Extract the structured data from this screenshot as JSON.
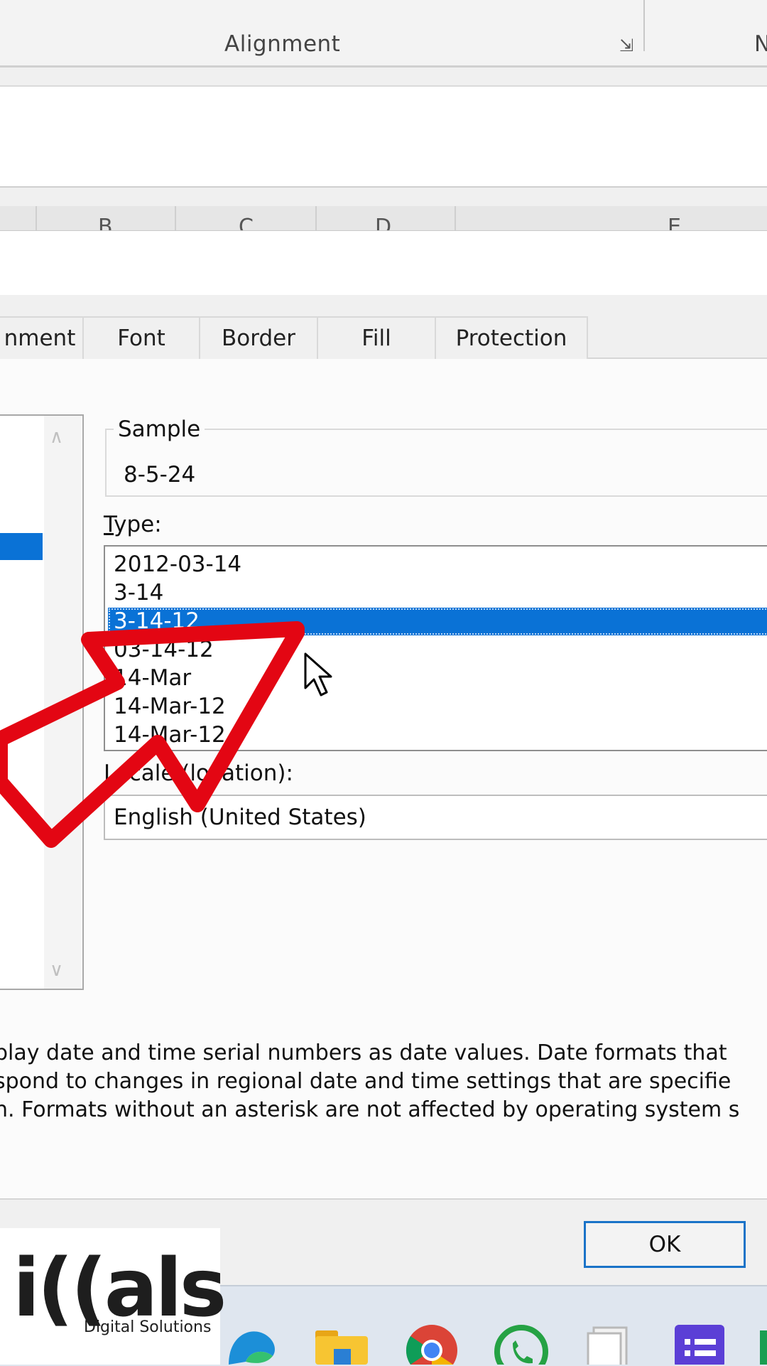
{
  "ribbon": {
    "group_label": "Alignment",
    "launcher_icon": "dialog-launcher-icon",
    "cut_label": "N"
  },
  "columns": [
    "B",
    "C",
    "D",
    "E"
  ],
  "tabs": [
    {
      "label": "nment"
    },
    {
      "label": "Font"
    },
    {
      "label": "Border"
    },
    {
      "label": "Fill"
    },
    {
      "label": "Protection"
    }
  ],
  "sample": {
    "title": "Sample",
    "value": "8-5-24"
  },
  "type": {
    "label_accel": "T",
    "label_rest": "ype:",
    "items": [
      {
        "label": "2012-03-14",
        "selected": false
      },
      {
        "label": "3-14",
        "selected": false
      },
      {
        "label": "3-14-12",
        "selected": true
      },
      {
        "label": "03-14-12",
        "selected": false
      },
      {
        "label": "14-Mar",
        "selected": false
      },
      {
        "label": "14-Mar-12",
        "selected": false
      },
      {
        "label": "14-Mar-12",
        "selected": false
      }
    ]
  },
  "locale": {
    "label": "Locale (location):",
    "value": "English (United States)"
  },
  "description": {
    "line1": "play date and time serial numbers as date values.  Date formats that",
    "line2": "spond to changes in regional date and time settings that are specifie",
    "line3": "n. Formats without an asterisk are not affected by operating system s"
  },
  "footer": {
    "ok_label": "OK"
  },
  "logo": {
    "word": "i((als",
    "subtitle": "Digital Solutions"
  },
  "colors": {
    "selection": "#0a72d6",
    "annotation": "#e30613",
    "ok_border": "#1a73c8"
  },
  "taskbar_icons": [
    "edge-icon",
    "file-explorer-icon",
    "chrome-icon",
    "whatsapp-icon",
    "documents-icon",
    "tasks-app-icon"
  ]
}
